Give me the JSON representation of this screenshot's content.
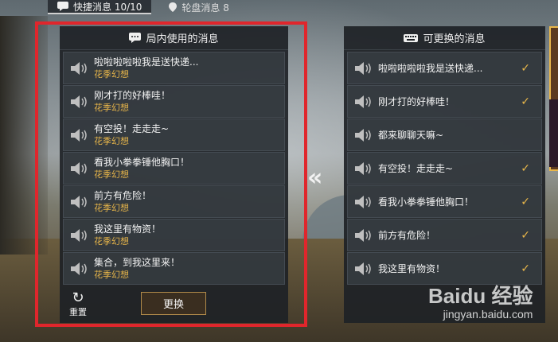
{
  "top_tabs": [
    {
      "label": "快捷消息 10/10",
      "active": true
    },
    {
      "label": "轮盘消息 8",
      "active": false
    }
  ],
  "left_panel": {
    "title": "局内使用的消息",
    "messages": [
      {
        "text": "啦啦啦啦啦我是送快递...",
        "author": "花季幻想"
      },
      {
        "text": "刚才打的好棒哇！",
        "author": "花季幻想"
      },
      {
        "text": "有空投！走走走~",
        "author": "花季幻想"
      },
      {
        "text": "看我小拳拳锤他胸口！",
        "author": "花季幻想"
      },
      {
        "text": "前方有危险！",
        "author": "花季幻想"
      },
      {
        "text": "我这里有物资！",
        "author": "花季幻想"
      },
      {
        "text": "集合，到我这里来！",
        "author": "花季幻想"
      }
    ],
    "reset_label": "重置",
    "swap_label": "更换"
  },
  "transfer_arrows": "«",
  "right_panel": {
    "title": "可更换的消息",
    "messages": [
      {
        "text": "啦啦啦啦啦我是送快递...",
        "checked": true
      },
      {
        "text": "刚才打的好棒哇！",
        "checked": true
      },
      {
        "text": "都来聊聊天嘛~",
        "checked": false
      },
      {
        "text": "有空投！走走走~",
        "checked": true
      },
      {
        "text": "看我小拳拳锤他胸口！",
        "checked": true
      },
      {
        "text": "前方有危险！",
        "checked": true
      },
      {
        "text": "我这里有物资！",
        "checked": true
      }
    ]
  },
  "watermark": {
    "logo": "Baidu 经验",
    "site": "jingyan.baidu.com"
  },
  "colors": {
    "accent_gold": "#e8b64a",
    "highlight_red": "#e0262c",
    "panel_bg": "#1e2226"
  }
}
